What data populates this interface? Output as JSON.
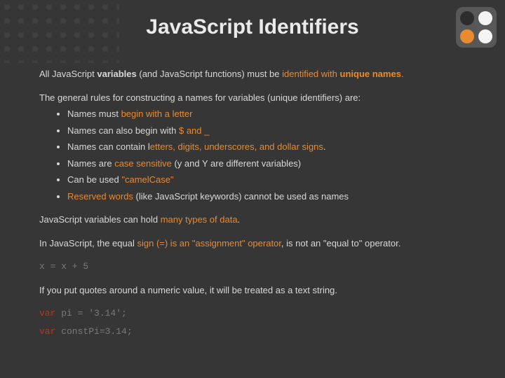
{
  "title": "JavaScript Identifiers",
  "p1": {
    "t1": "All JavaScript ",
    "t2": "variables",
    "t3": " (and JavaScript functions) must be ",
    "t4": "identified",
    "t5": " with ",
    "t6": "unique names",
    "t7": "."
  },
  "p2": "The general rules for constructing a names for variables (unique identifiers) are:",
  "bullets": {
    "b1a": "Names must ",
    "b1b": "begin with a letter",
    "b2a": "Names can also begin with ",
    "b2b": "$ and _",
    "b3a": "Names can contain l",
    "b3b": "etters, digits, underscores, and dollar signs",
    "b3c": ".",
    "b4a": "Names are ",
    "b4b": "case sensitive",
    "b4c": " (y and Y are different variables)",
    "b5a": "Can be used ",
    "b5b": "\"camelCase\"",
    "b6a": "Reserved words",
    "b6b": " (like JavaScript keywords) cannot be used as names"
  },
  "p3": {
    "t1": "JavaScript variables can hold ",
    "t2": "many types of data",
    "t3": "."
  },
  "p4": {
    "t1": "In JavaScript, the equal ",
    "t2": "sign (=) is an \"assignment\" operator",
    "t3": ", is not an \"equal to\" operator."
  },
  "code1": "x = x + 5",
  "p5": "If you put quotes around a numeric value, it will be treated as a text string.",
  "code2": {
    "kw": "var",
    "rest": " pi = '3.14';"
  },
  "code3": {
    "kw": "var",
    "rest": " constPi=3.14;"
  }
}
